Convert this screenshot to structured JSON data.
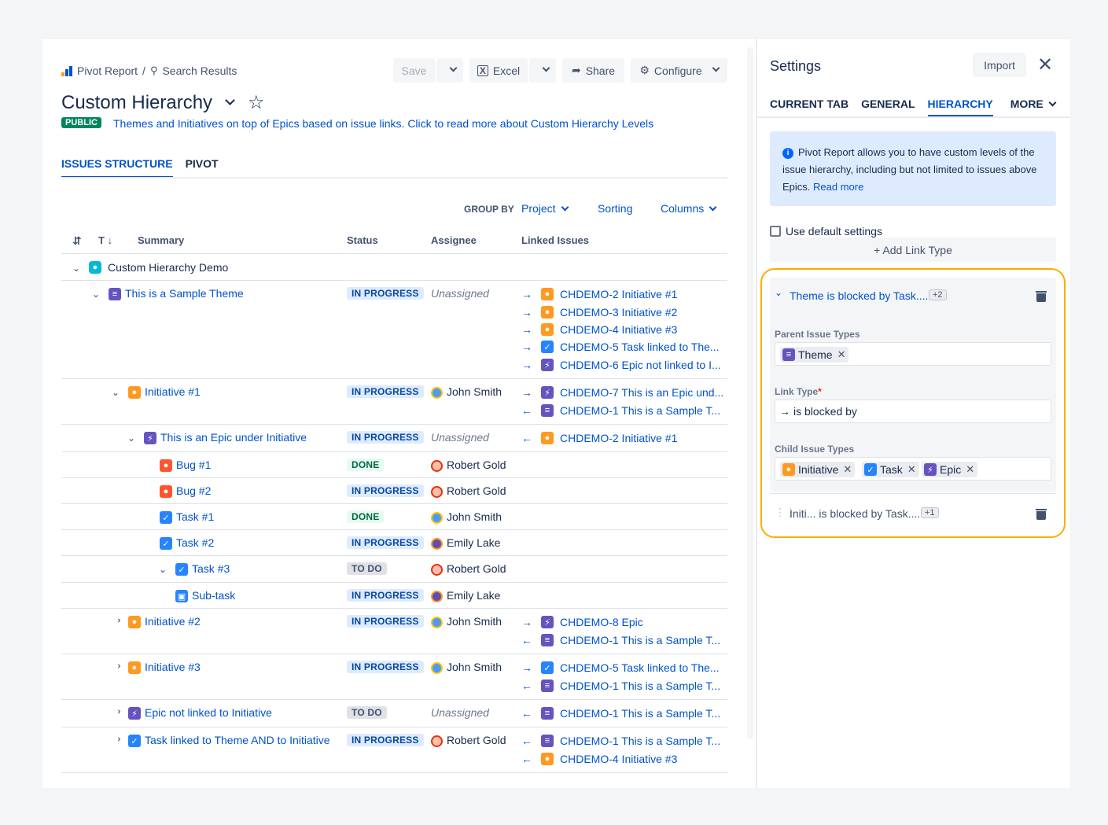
{
  "breadcrumb": {
    "root": "Pivot Report",
    "sep": "/",
    "current": "Search Results"
  },
  "toolbar": {
    "save": "Save",
    "excel": "Excel",
    "share": "Share",
    "configure": "Configure"
  },
  "page": {
    "title": "Custom Hierarchy",
    "badge": "PUBLIC",
    "description": "Themes and Initiatives on top of Epics based on issue links. Click to read more about Custom Hierarchy Levels"
  },
  "tabs": [
    "ISSUES STRUCTURE",
    "PIVOT"
  ],
  "controls": {
    "group_by_label": "GROUP BY",
    "group_by_value": "Project",
    "sorting": "Sorting",
    "columns": "Columns"
  },
  "table": {
    "headers": {
      "type": "T",
      "summary": "Summary",
      "status": "Status",
      "assignee": "Assignee",
      "linked": "Linked Issues"
    },
    "project": "Custom Hierarchy Demo",
    "rows": [
      {
        "summary": "This is a Sample Theme",
        "status": "IN PROGRESS",
        "assignee": "Unassigned",
        "links": [
          "CHDEMO-2 Initiative #1",
          "CHDEMO-3 Initiative #2",
          "CHDEMO-4 Initiative #3",
          "CHDEMO-5 Task linked to The...",
          "CHDEMO-6 Epic not linked to I..."
        ]
      },
      {
        "summary": "Initiative #1",
        "status": "IN PROGRESS",
        "assignee": "John Smith",
        "links": [
          "CHDEMO-7 This is an Epic und...",
          "CHDEMO-1 This is a Sample T..."
        ]
      },
      {
        "summary": "This is an Epic under Initiative",
        "status": "IN PROGRESS",
        "assignee": "Unassigned",
        "links": [
          "CHDEMO-2 Initiative #1"
        ]
      },
      {
        "summary": "Bug #1",
        "status": "DONE",
        "assignee": "Robert Gold",
        "links": []
      },
      {
        "summary": "Bug #2",
        "status": "IN PROGRESS",
        "assignee": "Robert Gold",
        "links": []
      },
      {
        "summary": "Task #1",
        "status": "DONE",
        "assignee": "John Smith",
        "links": []
      },
      {
        "summary": "Task #2",
        "status": "IN PROGRESS",
        "assignee": "Emily Lake",
        "links": []
      },
      {
        "summary": "Task #3",
        "status": "TO DO",
        "assignee": "Robert Gold",
        "links": []
      },
      {
        "summary": "Sub-task",
        "status": "IN PROGRESS",
        "assignee": "Emily Lake",
        "links": []
      },
      {
        "summary": "Initiative #2",
        "status": "IN PROGRESS",
        "assignee": "John Smith",
        "links": [
          "CHDEMO-8 Epic",
          "CHDEMO-1 This is a Sample T..."
        ]
      },
      {
        "summary": "Initiative #3",
        "status": "IN PROGRESS",
        "assignee": "John Smith",
        "links": [
          "CHDEMO-5 Task linked to The...",
          "CHDEMO-1 This is a Sample T..."
        ]
      },
      {
        "summary": "Epic not linked to Initiative",
        "status": "TO DO",
        "assignee": "Unassigned",
        "links": [
          "CHDEMO-1 This is a Sample T..."
        ]
      },
      {
        "summary": "Task linked to Theme AND to Initiative",
        "status": "IN PROGRESS",
        "assignee": "Robert Gold",
        "links": [
          "CHDEMO-1 This is a Sample T...",
          "CHDEMO-4 Initiative #3"
        ]
      }
    ]
  },
  "settings": {
    "title": "Settings",
    "import": "Import",
    "tabs": [
      "CURRENT TAB",
      "GENERAL",
      "HIERARCHY",
      "MORE"
    ],
    "info_line1": "Pivot Report allows you to have custom levels of the",
    "info_line2": "issue hierarchy, including but not limited to issues above",
    "info_line3": "Epics.",
    "info_link": "Read more",
    "use_default": "Use default settings",
    "add_link_type": "+ Add Link Type",
    "link_rule_1": {
      "title": "Theme is blocked by Task....",
      "badge": "+2",
      "parent_label": "Parent Issue Types",
      "parent_chips": [
        "Theme"
      ],
      "link_label": "Link Type",
      "required": "*",
      "link_value": "is blocked by",
      "child_label": "Child Issue Types",
      "child_chips": [
        "Initiative",
        "Task",
        "Epic"
      ]
    },
    "link_rule_2": {
      "title": "Initi... is blocked by Task....",
      "badge": "+1"
    }
  },
  "colors": {
    "accent": "#0052cc",
    "highlight": "#ffab00",
    "public": "#00875a"
  }
}
